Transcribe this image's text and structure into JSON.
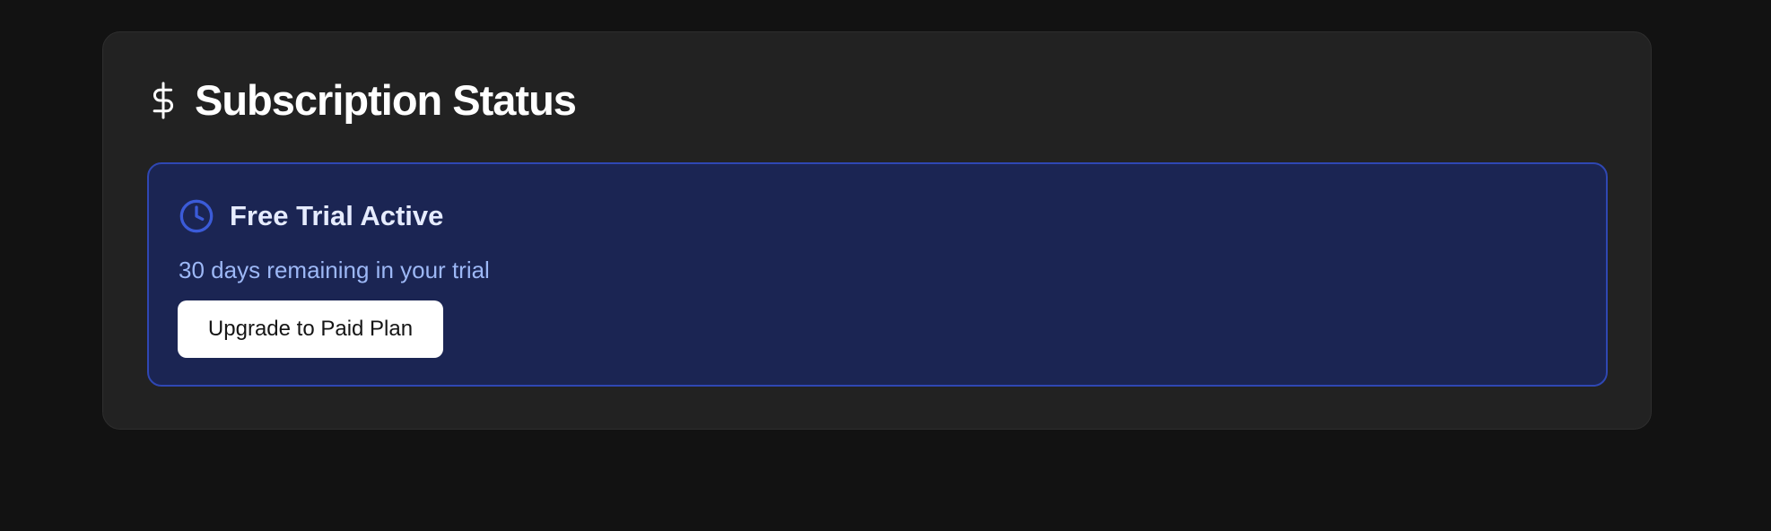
{
  "card": {
    "title": "Subscription Status",
    "icon": "dollar-icon"
  },
  "trial": {
    "icon": "clock-icon",
    "title": "Free Trial Active",
    "description": "30 days remaining in your trial",
    "upgrade_label": "Upgrade to Paid Plan"
  },
  "colors": {
    "page_bg": "#121212",
    "card_bg": "#222222",
    "panel_bg": "#1b2553",
    "panel_border": "#2f47b3",
    "clock_accent": "#3b5bd8",
    "description_text": "#9db8f6",
    "button_bg": "#ffffff"
  }
}
